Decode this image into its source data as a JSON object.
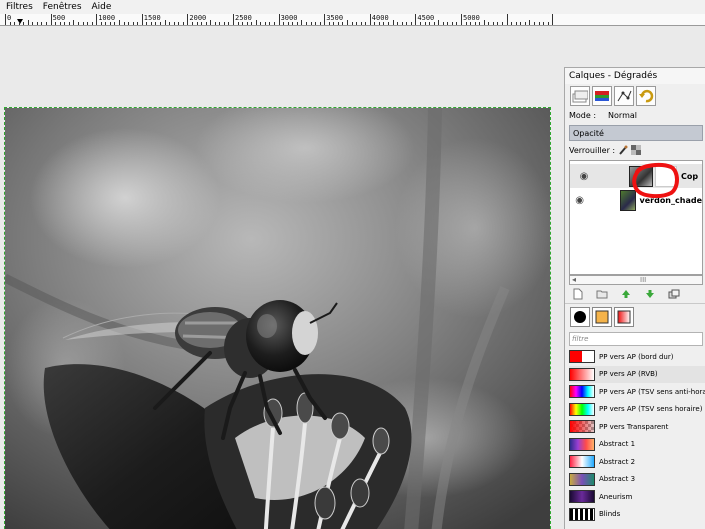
{
  "menubar": {
    "items": [
      "Filtres",
      "Fenêtres",
      "Aide"
    ]
  },
  "ruler": {
    "labels": [
      "0",
      "500",
      "1000",
      "1500",
      "2000",
      "2500",
      "3000",
      "3500",
      "4000",
      "4500",
      "5000"
    ]
  },
  "layers_dock": {
    "title": "Calques - Dégradés",
    "mode_label": "Mode :",
    "mode_value": "Normal",
    "opacity_label": "Opacité",
    "lock_label": "Verrouiller :",
    "layers": [
      {
        "name": "Cop",
        "visible": true,
        "selected": true
      },
      {
        "name": "verdon_chade",
        "visible": true,
        "selected": false
      }
    ],
    "scroll_grip": "III"
  },
  "gradients": {
    "filter_placeholder": "filtre",
    "items": [
      {
        "name": "PP vers AP (bord dur)",
        "colors": [
          "#ff0000",
          "#ff0000",
          "#ffffff",
          "#ffffff"
        ]
      },
      {
        "name": "PP vers AP (RVB)",
        "colors": [
          "#ff0000",
          "#ffffff"
        ],
        "selected": true
      },
      {
        "name": "PP vers AP (TSV sens anti-horaire)",
        "colors": [
          "#ff0000",
          "#ff00ff",
          "#0000ff",
          "#00ffff",
          "#ffffff"
        ]
      },
      {
        "name": "PP vers AP (TSV sens horaire)",
        "colors": [
          "#ff0000",
          "#ffff00",
          "#00ff00",
          "#00ffff",
          "#ffffff"
        ]
      },
      {
        "name": "PP vers Transparent",
        "colors": [
          "#ff0000",
          "#d45a5a",
          "#c8c8c8"
        ]
      },
      {
        "name": "Abstract 1",
        "colors": [
          "#2b2b8a",
          "#9a3fd4",
          "#ff4b4b",
          "#ffb36b"
        ]
      },
      {
        "name": "Abstract 2",
        "colors": [
          "#ff2244",
          "#ffffff",
          "#22aaff"
        ]
      },
      {
        "name": "Abstract 3",
        "colors": [
          "#c8aa40",
          "#7a4fb8",
          "#1d8a6a"
        ]
      },
      {
        "name": "Aneurism",
        "colors": [
          "#1a0a33",
          "#6a2a9a",
          "#1a0a33"
        ]
      },
      {
        "name": "Blinds",
        "colors": [
          "#000000",
          "#ffffff",
          "#000000",
          "#ffffff",
          "#000000"
        ]
      }
    ]
  },
  "colors": {
    "selection_border": "#2fa82f",
    "annotation": "#ee1111",
    "opacity_bar": "#c4c9d2"
  }
}
